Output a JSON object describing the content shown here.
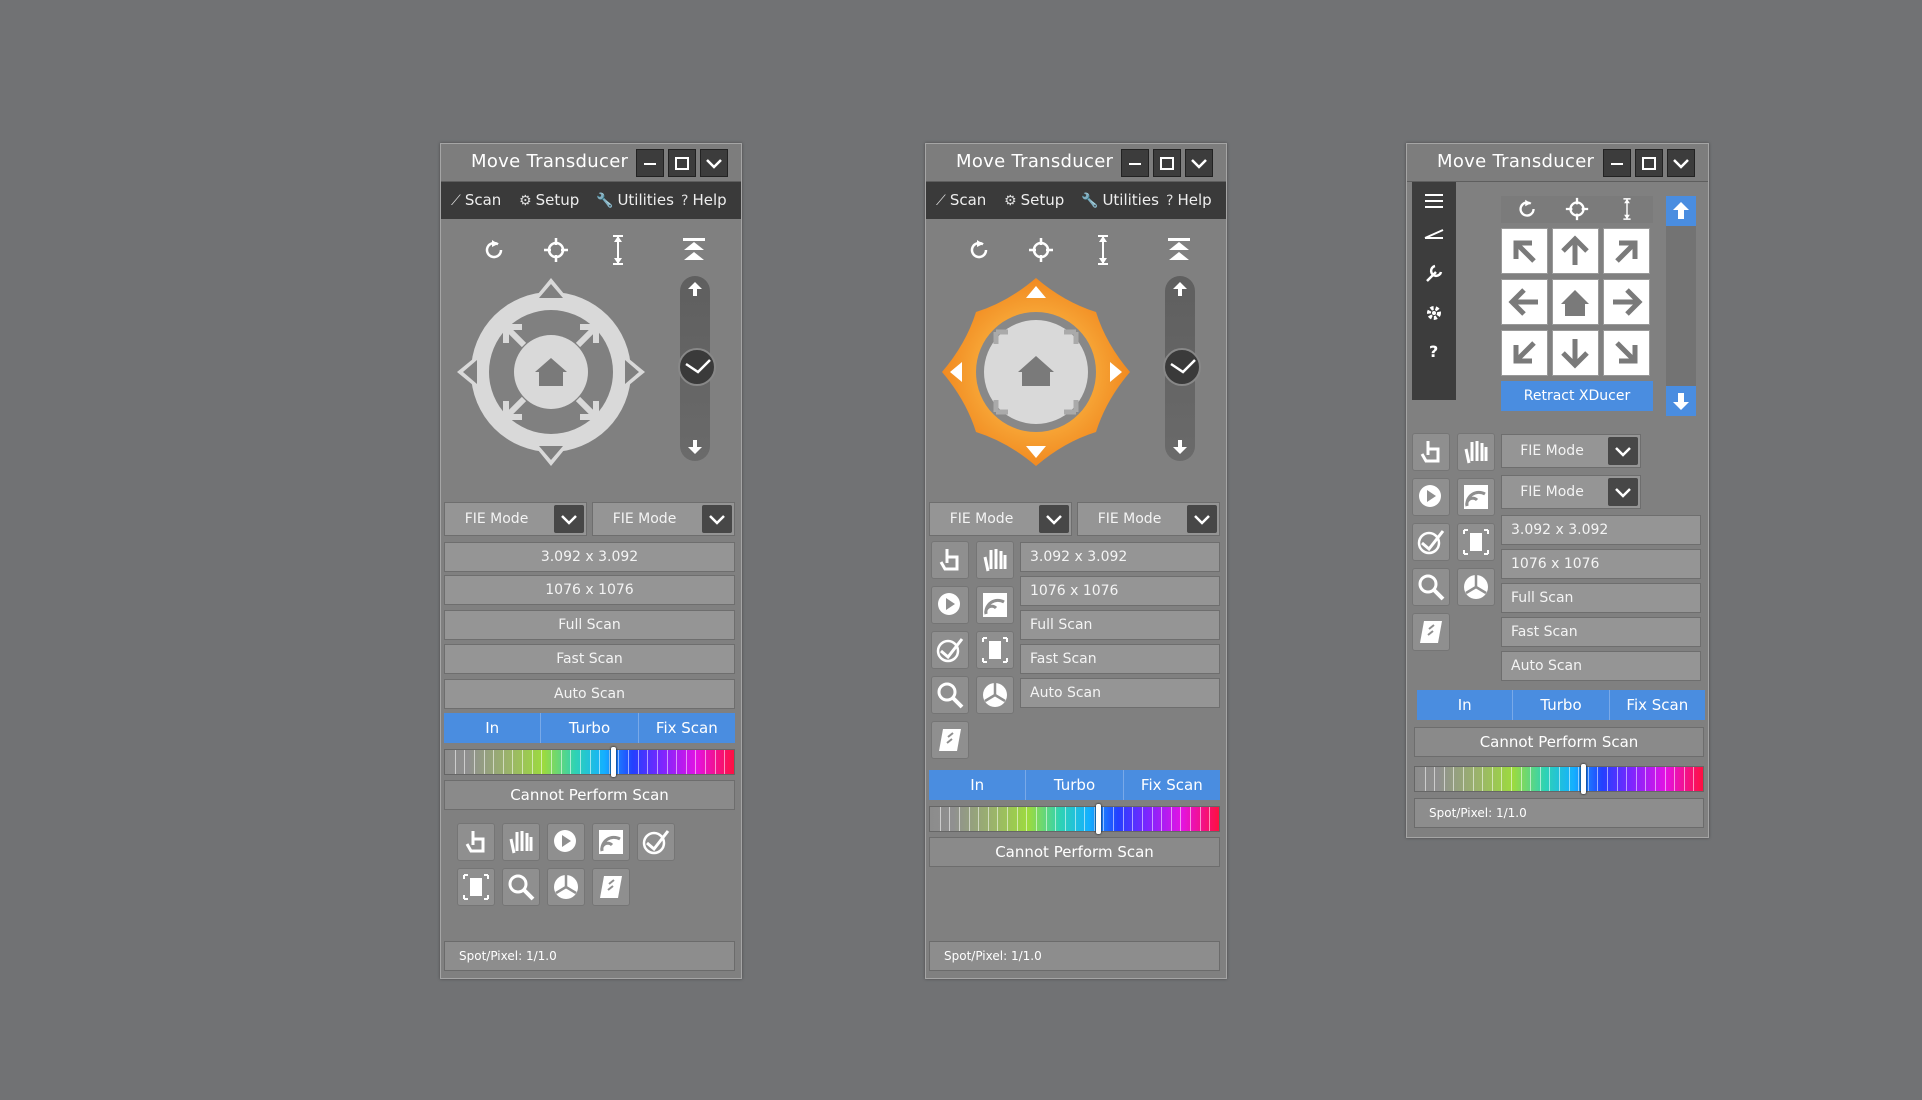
{
  "window": {
    "title": "Move Transducer"
  },
  "menu": {
    "scan": "Scan",
    "setup": "Setup",
    "utilities": "Utilities",
    "help": "Help"
  },
  "fie_mode": {
    "label": "FIE Mode"
  },
  "fields": {
    "size": "3.092 x 3.092",
    "resolution": "1076 x 1076",
    "full_scan": "Full Scan",
    "fast_scan": "Fast Scan",
    "auto_scan": "Auto Scan"
  },
  "segments": [
    "In",
    "Turbo",
    "Fix Scan"
  ],
  "status": {
    "message": "Cannot Perform Scan"
  },
  "footer": {
    "spot_pixel": "Spot/Pixel: 1/1.0"
  },
  "retract": {
    "label": "Retract XDucer"
  },
  "colors": {
    "accent": "#4a8de0",
    "panel": "#808080",
    "background": "#717274",
    "joystick_active": "#f39c1f"
  },
  "icons": [
    "rotate-icon",
    "target-icon",
    "z-axis-icon",
    "retract-top-icon",
    "arrow-up-icon",
    "arrow-down-icon",
    "slider-knob-icon",
    "home-icon",
    "finger-touch-icon",
    "hand-icon",
    "play-cursor-icon",
    "signal-icon",
    "plane-check-icon",
    "frame-icon",
    "zoom-icon",
    "pie-icon",
    "book-icon",
    "hamburger-icon",
    "wrench-icon",
    "gear-icon",
    "question-icon"
  ]
}
